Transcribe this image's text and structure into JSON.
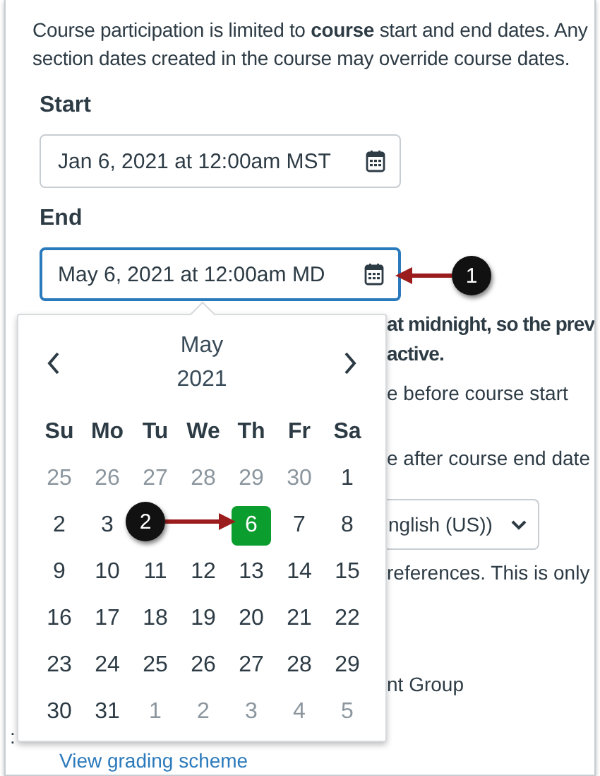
{
  "description": "Course participation is limited to **course** start and end dates. Any section dates created in the course may override course dates.",
  "start": {
    "label": "Start",
    "value": "Jan 6, 2021 at 12:00am MST",
    "focused": false
  },
  "end": {
    "label": "End",
    "value": "May 6, 2021 at 12:00am MD",
    "focused": true
  },
  "partly_hidden": [
    {
      "kind": "text",
      "text": "at midnight, so the prev",
      "bold": true
    },
    {
      "kind": "text",
      "text": "active.",
      "bold": true
    },
    {
      "kind": "text",
      "text": "e before course start",
      "bold": false
    },
    {
      "kind": "text",
      "text": "e after course end date",
      "bold": false
    },
    {
      "kind": "select",
      "text": "nglish (US))",
      "bold": false
    },
    {
      "kind": "text",
      "text": "references. This is only",
      "bold": false
    },
    {
      "kind": "text",
      "text": "nt Group",
      "bold": false
    }
  ],
  "colon": ":",
  "link": "View grading scheme",
  "calendar": {
    "month": "May",
    "year": "2021",
    "weekdays": [
      "Su",
      "Mo",
      "Tu",
      "We",
      "Th",
      "Fr",
      "Sa"
    ],
    "days": [
      {
        "kind": "day",
        "label": "25",
        "outside": true,
        "selected": false
      },
      {
        "kind": "day",
        "label": "26",
        "outside": true,
        "selected": false
      },
      {
        "kind": "day",
        "label": "27",
        "outside": true,
        "selected": false
      },
      {
        "kind": "day",
        "label": "28",
        "outside": true,
        "selected": false
      },
      {
        "kind": "day",
        "label": "29",
        "outside": true,
        "selected": false
      },
      {
        "kind": "day",
        "label": "30",
        "outside": true,
        "selected": false
      },
      {
        "kind": "day",
        "label": "1",
        "outside": false,
        "selected": false
      },
      {
        "kind": "day",
        "label": "2",
        "outside": false,
        "selected": false
      },
      {
        "kind": "day",
        "label": "3",
        "outside": false,
        "selected": false
      },
      {
        "kind": "covered"
      },
      {
        "kind": "covered"
      },
      {
        "kind": "day",
        "label": "6",
        "outside": false,
        "selected": true
      },
      {
        "kind": "day",
        "label": "7",
        "outside": false,
        "selected": false
      },
      {
        "kind": "day",
        "label": "8",
        "outside": false,
        "selected": false
      },
      {
        "kind": "day",
        "label": "9",
        "outside": false,
        "selected": false
      },
      {
        "kind": "day",
        "label": "10",
        "outside": false,
        "selected": false
      },
      {
        "kind": "day",
        "label": "11",
        "outside": false,
        "selected": false
      },
      {
        "kind": "day",
        "label": "12",
        "outside": false,
        "selected": false
      },
      {
        "kind": "day",
        "label": "13",
        "outside": false,
        "selected": false
      },
      {
        "kind": "day",
        "label": "14",
        "outside": false,
        "selected": false
      },
      {
        "kind": "day",
        "label": "15",
        "outside": false,
        "selected": false
      },
      {
        "kind": "day",
        "label": "16",
        "outside": false,
        "selected": false
      },
      {
        "kind": "day",
        "label": "17",
        "outside": false,
        "selected": false
      },
      {
        "kind": "day",
        "label": "18",
        "outside": false,
        "selected": false
      },
      {
        "kind": "day",
        "label": "19",
        "outside": false,
        "selected": false
      },
      {
        "kind": "day",
        "label": "20",
        "outside": false,
        "selected": false
      },
      {
        "kind": "day",
        "label": "21",
        "outside": false,
        "selected": false
      },
      {
        "kind": "day",
        "label": "22",
        "outside": false,
        "selected": false
      },
      {
        "kind": "day",
        "label": "23",
        "outside": false,
        "selected": false
      },
      {
        "kind": "day",
        "label": "24",
        "outside": false,
        "selected": false
      },
      {
        "kind": "day",
        "label": "25",
        "outside": false,
        "selected": false
      },
      {
        "kind": "day",
        "label": "26",
        "outside": false,
        "selected": false
      },
      {
        "kind": "day",
        "label": "27",
        "outside": false,
        "selected": false
      },
      {
        "kind": "day",
        "label": "28",
        "outside": false,
        "selected": false
      },
      {
        "kind": "day",
        "label": "29",
        "outside": false,
        "selected": false
      },
      {
        "kind": "day",
        "label": "30",
        "outside": false,
        "selected": false
      },
      {
        "kind": "day",
        "label": "31",
        "outside": false,
        "selected": false
      },
      {
        "kind": "day",
        "label": "1",
        "outside": true,
        "selected": false
      },
      {
        "kind": "day",
        "label": "2",
        "outside": true,
        "selected": false
      },
      {
        "kind": "day",
        "label": "3",
        "outside": true,
        "selected": false
      },
      {
        "kind": "day",
        "label": "4",
        "outside": true,
        "selected": false
      },
      {
        "kind": "day",
        "label": "5",
        "outside": true,
        "selected": false
      }
    ]
  },
  "callouts": [
    {
      "label": "1"
    },
    {
      "label": "2"
    }
  ]
}
